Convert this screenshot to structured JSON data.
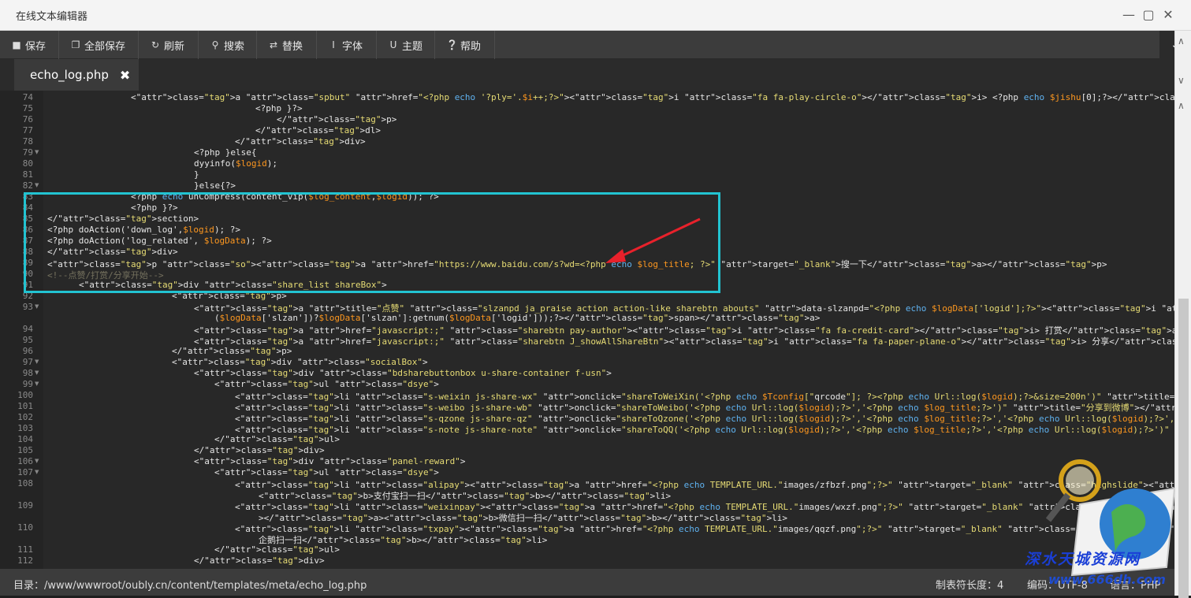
{
  "window": {
    "title": "在线文本编辑器"
  },
  "toolbar": {
    "save": "保存",
    "save_all": "全部保存",
    "refresh": "刷新",
    "search": "搜索",
    "replace": "替换",
    "font": "字体",
    "theme": "主题",
    "help": "帮助"
  },
  "tab": {
    "name": "echo_log.php"
  },
  "status": {
    "path": "目录：/www/wwwroot/oubly.cn/content/templates/meta/echo_log.php",
    "tab_size": "制表符长度：4",
    "encoding": "编码：UTF-8",
    "language": "语言：PHP"
  },
  "watermark": {
    "text": "深水天城资源网",
    "url": "www.666dh.com"
  },
  "colors": {
    "highlight": "#22c3d1",
    "arrow": "#e8212b"
  },
  "code": {
    "lines": [
      {
        "n": "74",
        "t": "<a class=\"spbut\" href=\"<?php echo '?ply='.$i++;?>\"><i class=\"fa fa-play-circle-o\"></i> <?php echo $jishu[0];?></a>"
      },
      {
        "n": "75",
        "t": "<?php }?>"
      },
      {
        "n": "76",
        "t": "</p>"
      },
      {
        "n": "77",
        "t": "</dl>"
      },
      {
        "n": "78",
        "t": "</div>"
      },
      {
        "n": "79",
        "t": "<?php }else{"
      },
      {
        "n": "80",
        "t": "dyyinfo($logid);"
      },
      {
        "n": "81",
        "t": "}"
      },
      {
        "n": "82",
        "t": "}else{?>"
      },
      {
        "n": "83",
        "t": "<?php echo unCompress(content_vip($log_content,$logid)); ?>"
      },
      {
        "n": "84",
        "t": "<?php }?>"
      },
      {
        "n": "85",
        "t": "</section>"
      },
      {
        "n": "86",
        "t": "<?php doAction('down_log',$logid); ?>"
      },
      {
        "n": "87",
        "t": "<?php doAction('log_related', $logData); ?>"
      },
      {
        "n": "88",
        "t": "</div>"
      },
      {
        "n": "89",
        "t": "<p class=\"so\"><a href=\"https://www.baidu.com/s?wd=<?php echo $log_title; ?>\" target=\"_blank\">搜一下</a></p>"
      },
      {
        "n": "90",
        "t": "<!--点赞/打赏/分享开始-->"
      },
      {
        "n": "91",
        "t": "<div class=\"share_list shareBox\">"
      },
      {
        "n": "92",
        "t": "<p>"
      },
      {
        "n": "93",
        "t": "<a title=\"点赞\" class=\"slzanpd ja_praise action action-like sharebtn abouts\" data-slzanpd=\"<?php echo $logData['logid'];?>\"><i class=\"fa fa-heart-o\"></i>点赞:<span><?php echo(isset"
      },
      {
        "n": "",
        "t": "($logData['slzan'])?$logData['slzan']:getnum($logData['logid']));?></span></a>"
      },
      {
        "n": "94",
        "t": "<a href=\"javascript:;\" class=\"sharebtn pay-author\"><i class=\"fa fa-credit-card\"></i> 打赏</a>"
      },
      {
        "n": "95",
        "t": "<a href=\"javascript:;\" class=\"sharebtn J_showAllShareBtn\"><i class=\"fa fa-paper-plane-o\"></i> 分享</a>"
      },
      {
        "n": "96",
        "t": "</p>"
      },
      {
        "n": "97",
        "t": "<div class=\"socialBox\">"
      },
      {
        "n": "98",
        "t": "<div class=\"bdsharebuttonbox u-share-container f-usn\">"
      },
      {
        "n": "99",
        "t": "<ul class=\"dsye\">"
      },
      {
        "n": "100",
        "t": "<li class=\"s-weixin js-share-wx\" onclick=\"shareToWeiXin('<?php echo $Tconfig[\"qrcode\"]; ?><?php echo Url::log($logid);?>&size=200n')\" title=\"分享到朋友圈\"></li>"
      },
      {
        "n": "101",
        "t": "<li class=\"s-weibo js-share-wb\" onclick=\"shareToWeibo('<?php echo Url::log($logid);?>','<?php echo $log_title;?>')\" title=\"分享到微博\"></li>"
      },
      {
        "n": "102",
        "t": "<li class=\"s-qzone js-share-qz\" onclick=\"shareToQzone('<?php echo Url::log($logid);?>','<?php echo $log_title;?>','<?php echo Url::log($logid);?>','')\" title=\"分享到QQ空间\"></li>"
      },
      {
        "n": "103",
        "t": "<li class=\"s-note js-share-note\" onclick=\"shareToQQ('<?php echo Url::log($logid);?>','<?php echo $log_title;?>','<?php echo Url::log($logid);?>')\" title=\"分享给QQ好友\"></li>"
      },
      {
        "n": "104",
        "t": "</ul>"
      },
      {
        "n": "105",
        "t": "</div>"
      },
      {
        "n": "106",
        "t": "<div class=\"panel-reward\">"
      },
      {
        "n": "107",
        "t": "<ul class=\"dsye\">"
      },
      {
        "n": "108",
        "t": "<li class=\"alipay\"><a href=\"<?php echo TEMPLATE_URL.\"images/zfbzf.png\";?>\" target=\"_blank\" class=\"highslide\"><img alt=\"打赏\" src=\"<?php echo TEMPLATE_URL.\"images/zf"
      },
      {
        "n": "",
        "t": "<b>支付宝扫一扫</b></li>"
      },
      {
        "n": "109",
        "t": "<li class=\"weixinpay\"><a href=\"<?php echo TEMPLATE_URL.\"images/wxzf.png\";?>\" target=\"_blank\" class=\"highslide\"><img alt=\"打赏\" src=\"<?php echo TEMPLATE_URL.\"images/w"
      },
      {
        "n": "",
        "t": "></a><b>微信扫一扫</b></li>"
      },
      {
        "n": "110",
        "t": "<li class=\"txpay\"><a href=\"<?php echo TEMPLATE_URL.\"images/qqzf.png\";?>\" target=\"_blank\" class=\"highslide\"><img alt=\"打赏\" src=\"<?php echo TEMPLATE_URL.\"images/qqzf"
      },
      {
        "n": "",
        "t": "企鹅扫一扫</b></li>"
      },
      {
        "n": "111",
        "t": "</ul>"
      },
      {
        "n": "112",
        "t": "</div>"
      }
    ]
  }
}
